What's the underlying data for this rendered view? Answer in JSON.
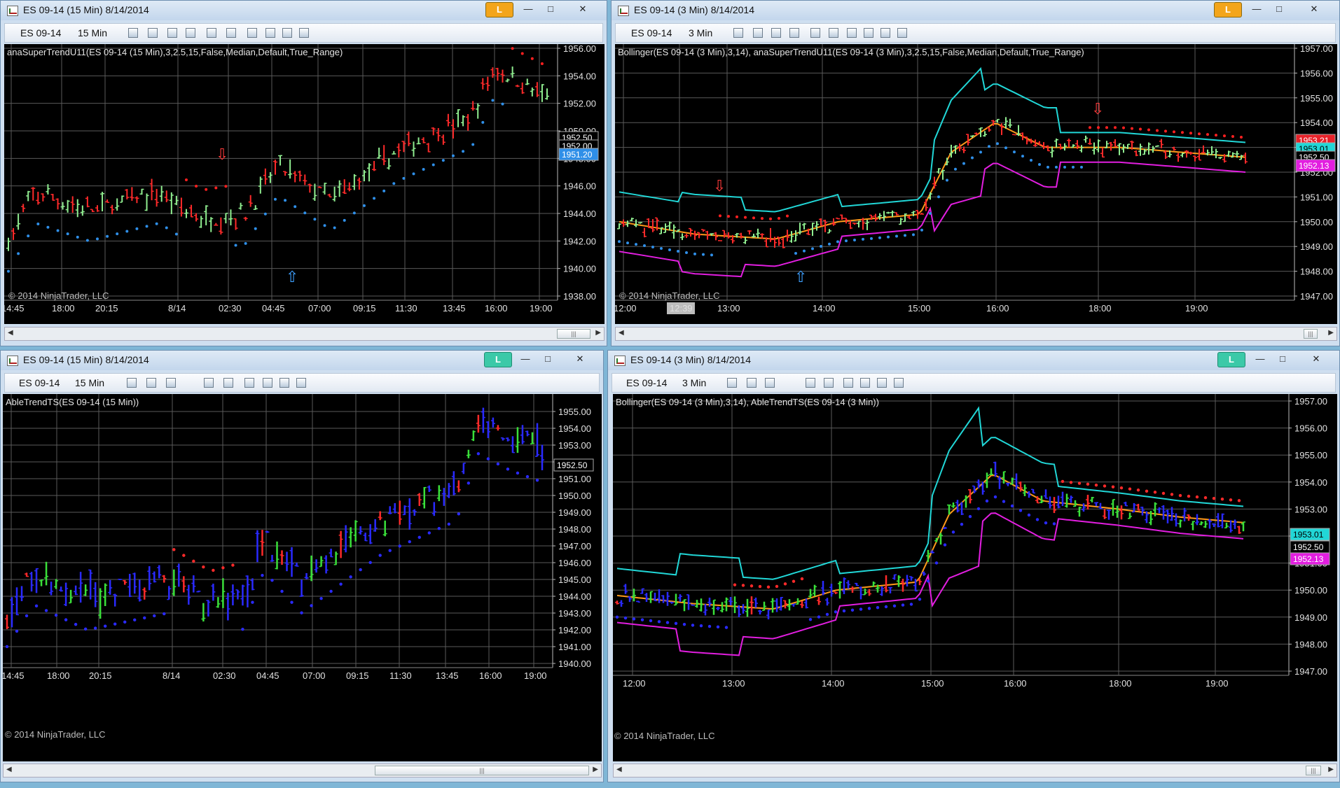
{
  "windows": [
    {
      "id": "w1",
      "title": "ES 09-14 (15 Min)  8/14/2014",
      "lock_label": "L",
      "lock_color": "#f3a51b",
      "toolbar": {
        "instrument": "ES 09-14",
        "interval": "15 Min"
      },
      "indicator_label": "anaSuperTrendU11(ES  09-14  (15  Min),3,2.5,15,False,Median,Default,True_Range)",
      "copyright": "© 2014 NinjaTrader, LLC",
      "price_ticks": [
        "1956.00",
        "1954.00",
        "1952.00",
        "1950.00",
        "1948.00",
        "1946.00",
        "1944.00",
        "1942.00",
        "1940.00",
        "1938.00"
      ],
      "time_ticks": [
        "14:45",
        "18:00",
        "20:15",
        "8/14",
        "02:30",
        "04:45",
        "07:00",
        "09:15",
        "11:30",
        "13:45",
        "16:00",
        "19:00"
      ],
      "price_markers": [
        {
          "text": "1952.50",
          "bg": "#000000",
          "fg": "#ffffff"
        },
        {
          "text": "1952.00",
          "bg": "#000000",
          "fg": "#ffffff"
        },
        {
          "text": "1951.20",
          "bg": "#2f8fe8",
          "fg": "#ffffff"
        }
      ],
      "style": "supertrend"
    },
    {
      "id": "w2",
      "title": "ES 09-14 (3 Min)  8/14/2014",
      "lock_label": "L",
      "lock_color": "#f3a51b",
      "toolbar": {
        "instrument": "ES 09-14",
        "interval": "3 Min"
      },
      "indicator_label": "Bollinger(ES  09-14  (3  Min),3,14),  anaSuperTrendU11(ES  09-14  (3  Min),3,2.5,15,False,Median,Default,True_Range)",
      "copyright": "© 2014 NinjaTrader, LLC",
      "price_ticks": [
        "1957.00",
        "1956.00",
        "1955.00",
        "1954.00",
        "1953.00",
        "1952.00",
        "1951.00",
        "1950.00",
        "1949.00",
        "1948.00",
        "1947.00"
      ],
      "time_ticks": [
        "12:00",
        "12:39",
        "13:00",
        "14:00",
        "15:00",
        "16:00",
        "18:00",
        "19:00"
      ],
      "price_markers": [
        {
          "text": "1953.21",
          "bg": "#e8222a",
          "fg": "#ffffff"
        },
        {
          "text": "1953.01",
          "bg": "#21d7d7",
          "fg": "#000000"
        },
        {
          "text": "1952.50",
          "bg": "#000000",
          "fg": "#ffffff"
        },
        {
          "text": "1952.13",
          "bg": "#e21ee0",
          "fg": "#ffffff"
        }
      ],
      "style": "supertrend-bb"
    },
    {
      "id": "w3",
      "title": "ES 09-14 (15 Min)  8/14/2014",
      "lock_label": "L",
      "lock_color": "#3bc9a8",
      "toolbar": {
        "instrument": "ES 09-14",
        "interval": "15 Min"
      },
      "indicator_label": "AbleTrendTS(ES 09-14 (15 Min))",
      "copyright": "© 2014 NinjaTrader, LLC",
      "price_ticks": [
        "1955.00",
        "1954.00",
        "1953.00",
        "1952.00",
        "1951.00",
        "1950.00",
        "1949.00",
        "1948.00",
        "1947.00",
        "1946.00",
        "1945.00",
        "1944.00",
        "1943.00",
        "1942.00",
        "1941.00",
        "1940.00"
      ],
      "time_ticks": [
        "14:45",
        "18:00",
        "20:15",
        "8/14",
        "02:30",
        "04:45",
        "07:00",
        "09:15",
        "11:30",
        "13:45",
        "16:00",
        "19:00"
      ],
      "price_markers": [
        {
          "text": "1952.50",
          "bg": "#000000",
          "fg": "#ffffff"
        }
      ],
      "style": "abletrend"
    },
    {
      "id": "w4",
      "title": "ES 09-14 (3 Min)  8/14/2014",
      "lock_label": "L",
      "lock_color": "#3bc9a8",
      "toolbar": {
        "instrument": "ES 09-14",
        "interval": "3 Min"
      },
      "indicator_label": "Bollinger(ES 09-14 (3 Min),3,14), AbleTrendTS(ES 09-14 (3 Min))",
      "copyright": "© 2014 NinjaTrader, LLC",
      "price_ticks": [
        "1957.00",
        "1956.00",
        "1955.00",
        "1954.00",
        "1953.00",
        "1952.00",
        "1951.00",
        "1950.00",
        "1949.00",
        "1948.00",
        "1947.00"
      ],
      "time_ticks": [
        "12:00",
        "13:00",
        "14:00",
        "15:00",
        "16:00",
        "18:00",
        "19:00"
      ],
      "price_markers": [
        {
          "text": "1953.01",
          "bg": "#21d7d7",
          "fg": "#000000"
        },
        {
          "text": "1952.50",
          "bg": "#000000",
          "fg": "#ffffff"
        },
        {
          "text": "1952.13",
          "bg": "#e21ee0",
          "fg": "#ffffff"
        }
      ],
      "style": "abletrend-bb"
    }
  ],
  "colors": {
    "up_bar": "#90ee90",
    "down_bar": "#ff2a2a",
    "supertrend_up": "#2f8fe8",
    "supertrend_down": "#ff2020",
    "able_up": "#2a2aff",
    "able_dn": "#ff2a2a",
    "bb_upper": "#21d7d7",
    "bb_lower": "#e21ee0",
    "bb_mid": "#ff9a1a",
    "grid": "#5a5a5a"
  }
}
